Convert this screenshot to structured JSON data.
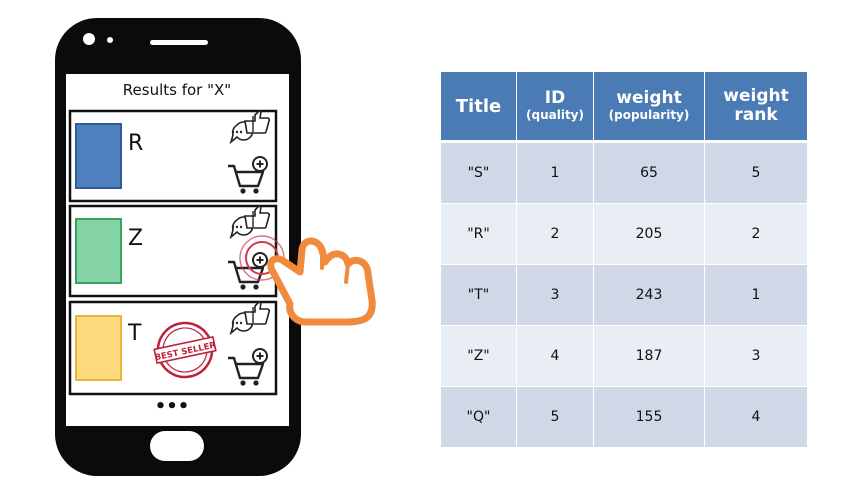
{
  "phone": {
    "screen_title": "Results for \"X\"",
    "more_indicator": "•••",
    "products": [
      {
        "label": "R",
        "color": "#4f7fbf",
        "border": "#2e5d94"
      },
      {
        "label": "Z",
        "color": "#83d3a6",
        "border": "#3aa362"
      },
      {
        "label": "T",
        "color": "#ffd97e",
        "border": "#e8b43c"
      }
    ],
    "badge_text": "BEST SELLER",
    "icons": [
      "review-icon",
      "add-to-cart-icon",
      "tap-hand-icon",
      "best-seller-badge-icon"
    ]
  },
  "table": {
    "headers": [
      {
        "main": "Title",
        "sub": ""
      },
      {
        "main": "ID",
        "sub": "(quality)"
      },
      {
        "main": "weight",
        "sub": "(popularity)"
      },
      {
        "main": "weight",
        "sub": "rank"
      }
    ],
    "rows": [
      {
        "title": "\"S\"",
        "id": "1",
        "weight": "65",
        "rank": "5"
      },
      {
        "title": "\"R\"",
        "id": "2",
        "weight": "205",
        "rank": "2"
      },
      {
        "title": "\"T\"",
        "id": "3",
        "weight": "243",
        "rank": "1"
      },
      {
        "title": "\"Z\"",
        "id": "4",
        "weight": "187",
        "rank": "3"
      },
      {
        "title": "\"Q\"",
        "id": "5",
        "weight": "155",
        "rank": "4"
      }
    ]
  },
  "colors": {
    "header_bg": "#4b7bb5",
    "row_dark": "#d0d8e8",
    "row_light": "#e9edf4",
    "hand_outline": "#f08a3c",
    "badge": "#c0203a"
  }
}
